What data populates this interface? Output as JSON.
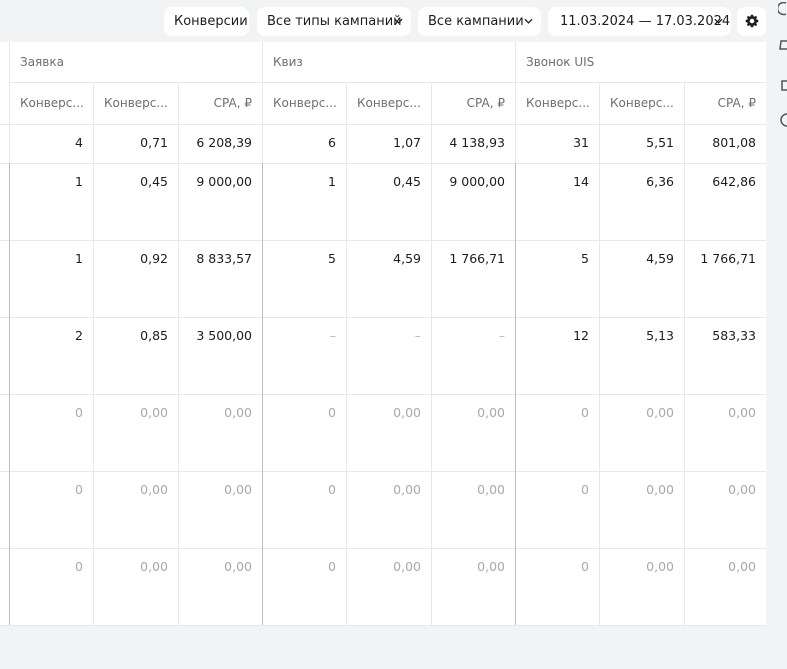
{
  "toolbar": {
    "conversions_label": "Конверсии",
    "campaign_types_label": "Все типы кампаний",
    "campaigns_label": "Все кампании",
    "date_range_label": "11.03.2024 — 17.03.2024"
  },
  "groups": [
    {
      "title": "Заявка",
      "columns": [
        "Конверс...",
        "Конверс...",
        "CPA, ₽"
      ]
    },
    {
      "title": "Квиз",
      "columns": [
        "Конверс...",
        "Конверс...",
        "CPA, ₽"
      ]
    },
    {
      "title": "Звонок UIS",
      "columns": [
        "Конверс...",
        "Конверс...",
        "CPA, ₽"
      ]
    }
  ],
  "total_row": [
    "4",
    "0,71",
    "6 208,39",
    "6",
    "1,07",
    "4 138,93",
    "31",
    "5,51",
    "801,08"
  ],
  "rows": [
    [
      "1",
      "0,45",
      "9 000,00",
      "1",
      "0,45",
      "9 000,00",
      "14",
      "6,36",
      "642,86"
    ],
    [
      "1",
      "0,92",
      "8 833,57",
      "5",
      "4,59",
      "1 766,71",
      "5",
      "4,59",
      "1 766,71"
    ],
    [
      "2",
      "0,85",
      "3 500,00",
      "–",
      "–",
      "–",
      "12",
      "5,13",
      "583,33"
    ],
    [
      "0",
      "0,00",
      "0,00",
      "0",
      "0,00",
      "0,00",
      "0",
      "0,00",
      "0,00"
    ],
    [
      "0",
      "0,00",
      "0,00",
      "0",
      "0,00",
      "0,00",
      "0",
      "0,00",
      "0,00"
    ],
    [
      "0",
      "0,00",
      "0,00",
      "0",
      "0,00",
      "0,00",
      "0",
      "0,00",
      "0,00"
    ]
  ],
  "colors": {
    "accent_border": "#b9bcc4",
    "dim_text": "#a7a9ae",
    "background": "#f2f3f5"
  },
  "icons": {
    "dropdown": "chevron-down-icon",
    "settings": "gear-icon"
  }
}
